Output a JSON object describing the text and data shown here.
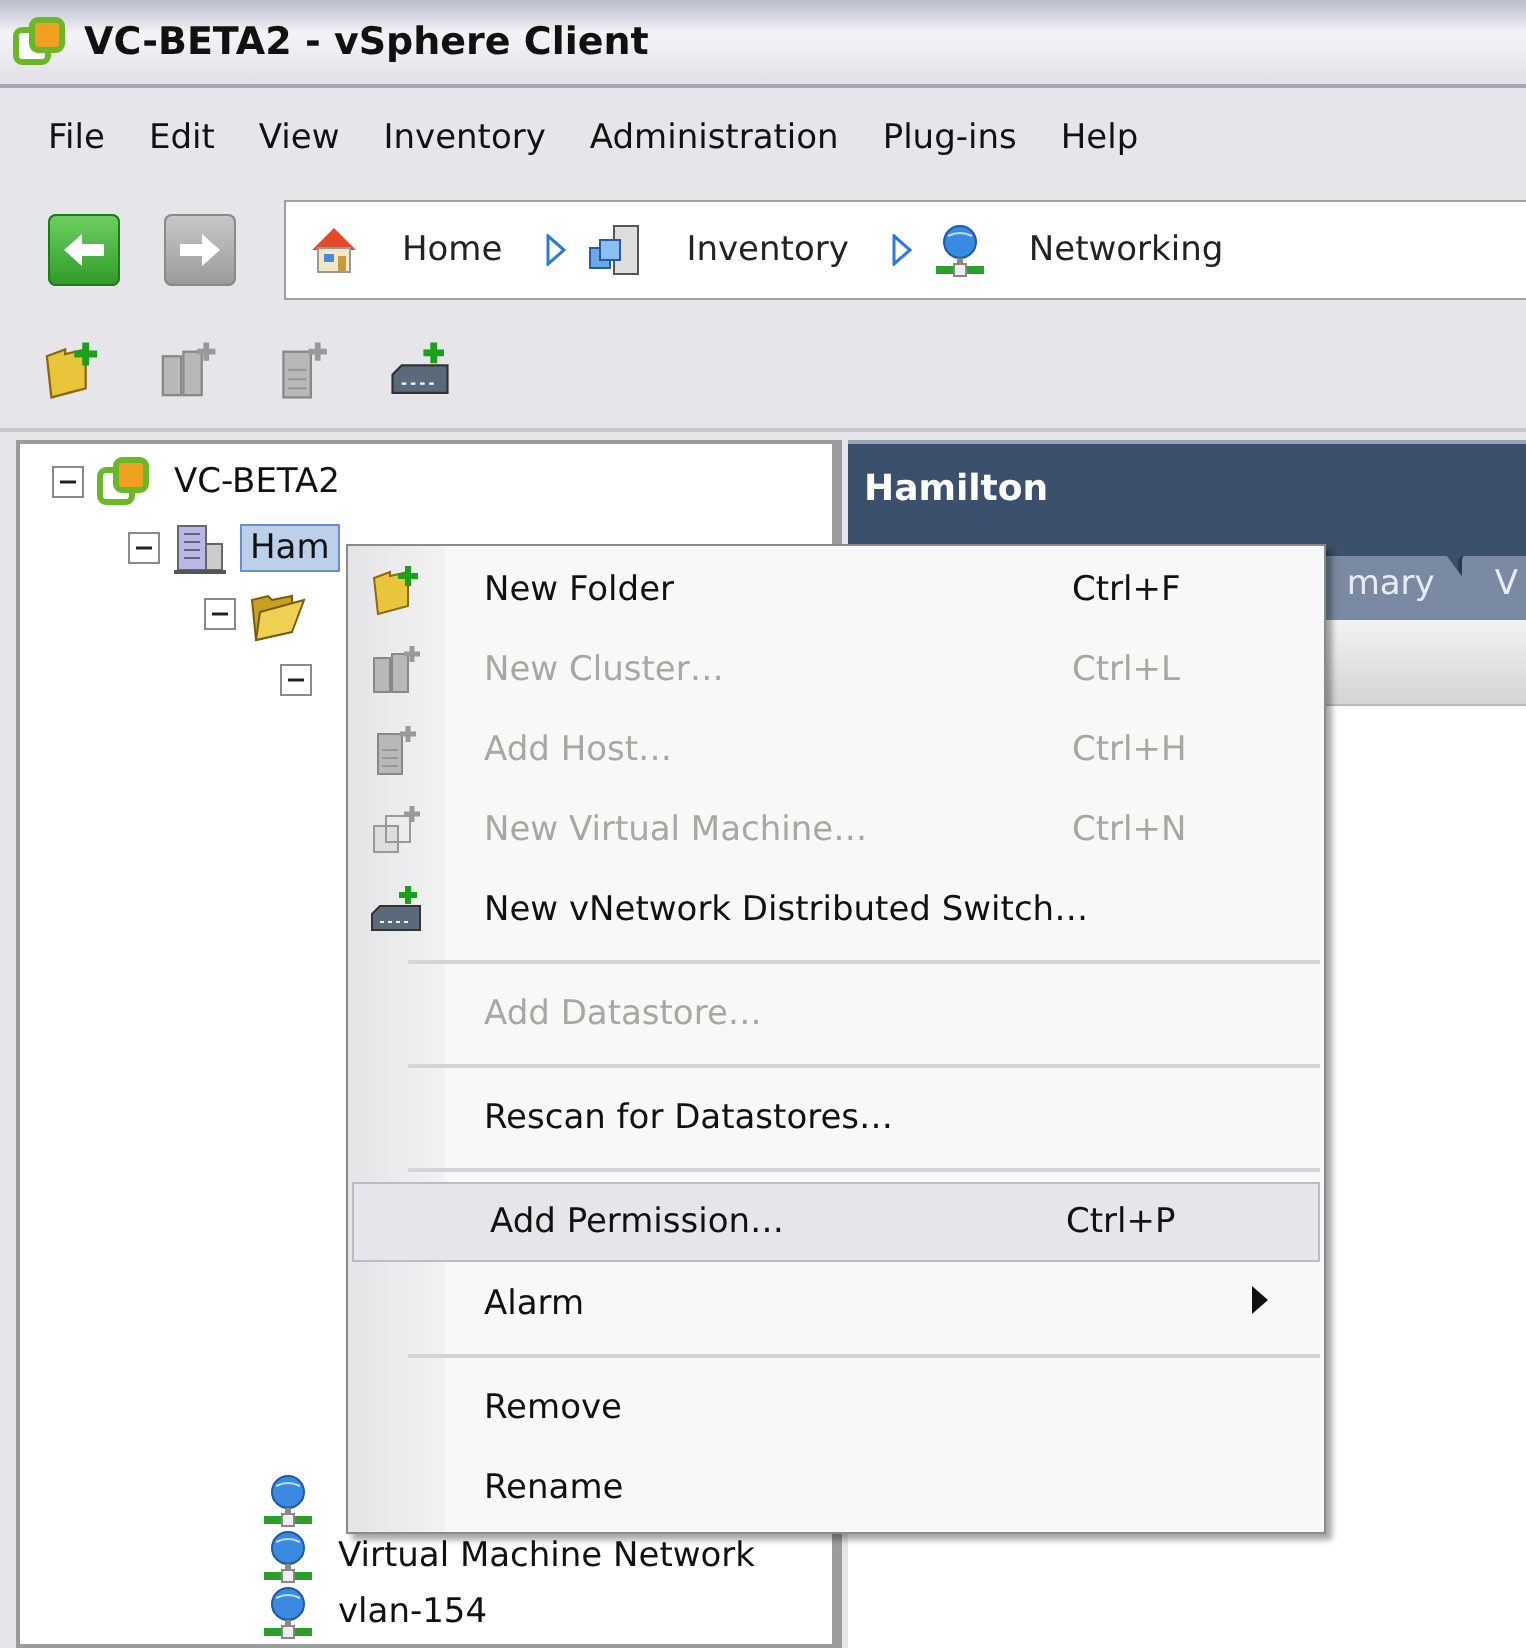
{
  "window": {
    "title": "VC-BETA2 - vSphere Client"
  },
  "menu_bar": [
    "File",
    "Edit",
    "View",
    "Inventory",
    "Administration",
    "Plug-ins",
    "Help"
  ],
  "navigation": {
    "back": {
      "disabled": false
    },
    "forward": {
      "disabled": true
    },
    "breadcrumb": [
      "Home",
      "Inventory",
      "Networking"
    ]
  },
  "toolbar": [
    {
      "kind": "folder",
      "disabled": false
    },
    {
      "kind": "cluster",
      "disabled": true
    },
    {
      "kind": "host",
      "disabled": true
    },
    {
      "kind": "switch",
      "disabled": false
    }
  ],
  "tree": [
    {
      "label": "VC-BETA2",
      "kind": "vcenter",
      "expanded": true,
      "selected": false,
      "children": [
        {
          "label": "Ham",
          "kind": "datacenter",
          "expanded": true,
          "selected": true,
          "children": [
            {
              "kind": "folder",
              "expanded": true,
              "children": [
                {
                  "expanded": true
                }
              ]
            }
          ]
        }
      ]
    }
  ],
  "tree_bottom": [
    {
      "kind": "network"
    },
    {
      "label": "Virtual Machine Network",
      "kind": "network"
    },
    {
      "label": "vlan-154",
      "kind": "network"
    }
  ],
  "detail": {
    "title": "Hamilton",
    "tabs": [
      "mary",
      "V"
    ]
  },
  "context_menu": [
    {
      "kind": "item",
      "label": "New Folder",
      "shortcut": "Ctrl+F",
      "disabled": false,
      "selected": false
    },
    {
      "kind": "item",
      "label": "New Cluster…",
      "shortcut": "Ctrl+L",
      "disabled": true,
      "selected": false
    },
    {
      "kind": "item",
      "label": "Add Host…",
      "shortcut": "Ctrl+H",
      "disabled": true,
      "selected": false
    },
    {
      "kind": "item",
      "label": "New Virtual Machine…",
      "shortcut": "Ctrl+N",
      "disabled": true,
      "selected": false
    },
    {
      "kind": "item",
      "label": "New vNetwork Distributed Switch…",
      "disabled": false,
      "selected": false
    },
    {
      "kind": "separator"
    },
    {
      "kind": "item",
      "label": "Add Datastore…",
      "disabled": true,
      "selected": false
    },
    {
      "kind": "separator"
    },
    {
      "kind": "item",
      "label": "Rescan for Datastores…",
      "disabled": false,
      "selected": false
    },
    {
      "kind": "separator"
    },
    {
      "kind": "item",
      "label": "Add Permission…",
      "shortcut": "Ctrl+P",
      "disabled": false,
      "selected": true
    },
    {
      "kind": "submenu",
      "label": "Alarm",
      "disabled": false,
      "selected": false
    },
    {
      "kind": "separator"
    },
    {
      "kind": "item",
      "label": "Remove",
      "disabled": false,
      "selected": false
    },
    {
      "kind": "item",
      "label": "Rename",
      "disabled": false,
      "selected": false
    }
  ]
}
